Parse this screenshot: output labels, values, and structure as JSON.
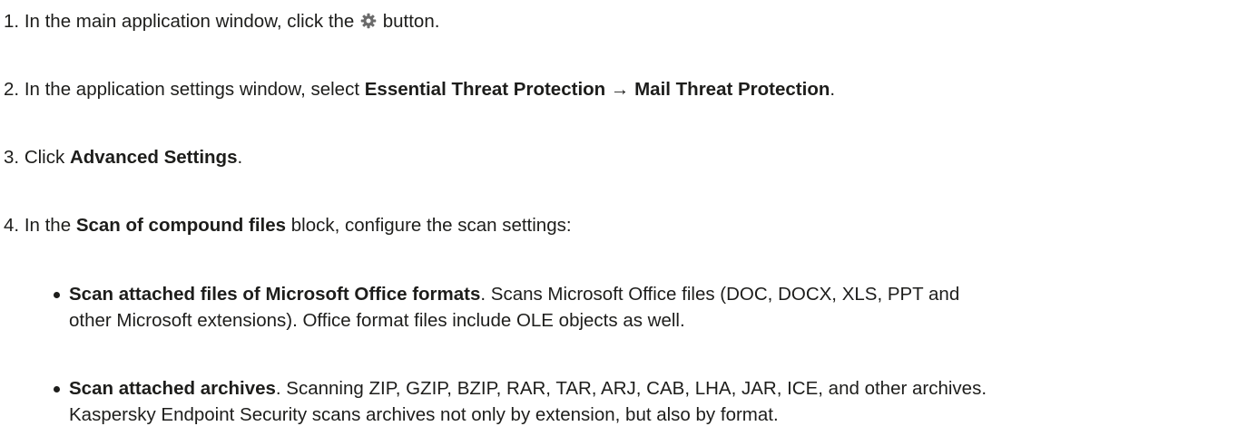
{
  "steps": [
    {
      "number": "1.",
      "before": "In the main application window, click the",
      "icon": "gear-icon",
      "after": "button."
    },
    {
      "number": "2.",
      "before": "In the application settings window, select",
      "bold1": "Essential Threat Protection",
      "arrow": "→",
      "bold2": "Mail Threat Protection",
      "after": "."
    },
    {
      "number": "3.",
      "before": "Click",
      "bold": "Advanced Settings",
      "after": "."
    },
    {
      "number": "4.",
      "before": "In the",
      "bold": "Scan of compound files",
      "after": "block, configure the scan settings:"
    }
  ],
  "options": [
    {
      "title": "Scan attached files of Microsoft Office formats",
      "description_line1": ". Scans Microsoft Office files (DOC, DOCX, XLS, PPT and",
      "description_line2": "other Microsoft extensions). Office format files include OLE objects as well."
    },
    {
      "title": "Scan attached archives",
      "description_line1": ". Scanning ZIP, GZIP, BZIP, RAR, TAR, ARJ, CAB, LHA, JAR, ICE, and other archives.",
      "description_line2": "Kaspersky Endpoint Security scans archives not only by extension, but also by format."
    }
  ]
}
